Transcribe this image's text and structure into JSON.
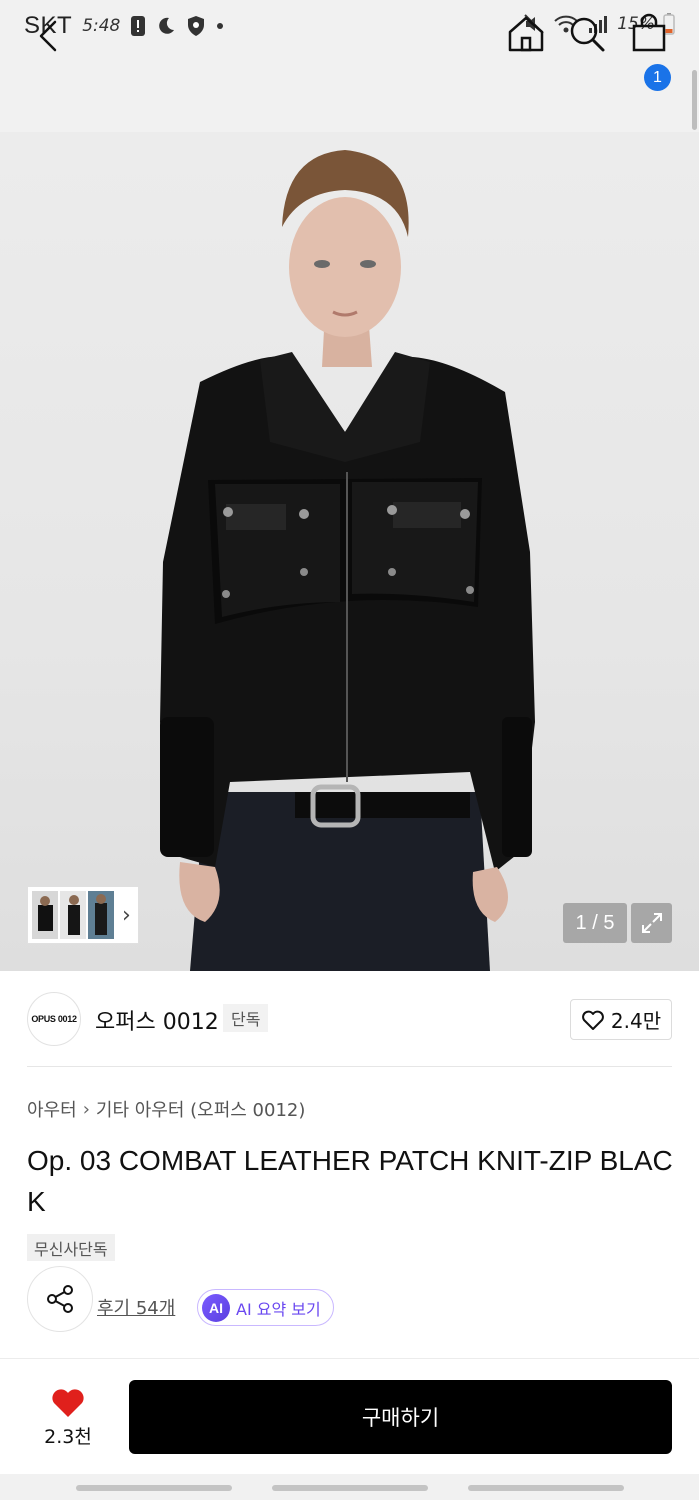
{
  "status_bar": {
    "carrier": "SKT",
    "time": "5:48",
    "battery": "15%"
  },
  "header": {
    "cart_count": "1"
  },
  "gallery": {
    "counter": "1 / 5"
  },
  "brand": {
    "logo_text": "OPUS 0012",
    "name": "오퍼스 0012",
    "tag": "단독",
    "likes": "2.4만"
  },
  "breadcrumb": [
    "아우터",
    "기타 아우터 (오퍼스 0012)"
  ],
  "product": {
    "title": "Op. 03 COMBAT LEATHER PATCH KNIT-ZIP BLACK",
    "exclusive_badge": "무신사단독",
    "review_link": "후기 54개",
    "ai_badge": "AI",
    "ai_label": "AI 요약 보기"
  },
  "bottom_bar": {
    "favorite_count": "2.3천",
    "buy_label": "구매하기"
  },
  "colors": {
    "accent_blue": "#1a73e8",
    "heart_red": "#e0201c",
    "buy_button": "#000000",
    "ai_purple": "#6a48f0"
  }
}
